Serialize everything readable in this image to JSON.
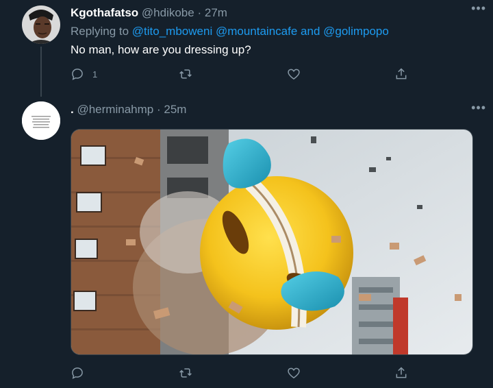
{
  "colors": {
    "background": "#15202b",
    "link": "#1d9bf0",
    "secondary_text": "#8899a6",
    "primary_text": "#ffffff"
  },
  "tweets": [
    {
      "display_name": "Kgothafatso",
      "handle": "@hdikobe",
      "separator": "·",
      "time": "27m",
      "replying_prefix": "Replying to",
      "replying_to": [
        "@tito_mboweni",
        "@mountaincafe",
        "@golimpopo"
      ],
      "replying_joiner": "and",
      "text": "No man, how are you dressing up?",
      "reply_count": "1",
      "icons": [
        "reply-icon",
        "retweet-icon",
        "like-icon",
        "share-icon",
        "more-icon"
      ]
    },
    {
      "display_name": ".",
      "handle": "@herminahmp",
      "separator": "·",
      "time": "25m",
      "media": {
        "description_icon": "laughing-emoji-image",
        "accent_colors": [
          "#f4c21c",
          "#2bb3cf",
          "#8a5a3c",
          "#b8c4cc"
        ]
      },
      "icons": [
        "reply-icon",
        "retweet-icon",
        "like-icon",
        "share-icon",
        "more-icon"
      ]
    }
  ]
}
